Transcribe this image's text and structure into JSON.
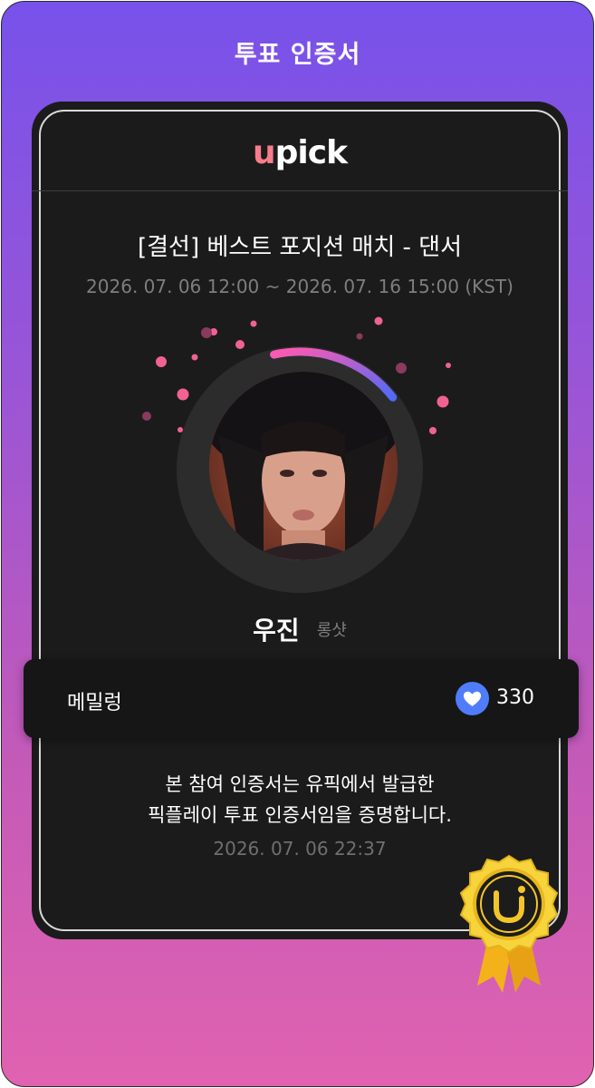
{
  "header": {
    "title": "투표 인증서"
  },
  "card": {
    "logo": {
      "u": "u",
      "rest": "pick"
    },
    "vote_title": "[결선] 베스트 포지션 매치 - 댄서",
    "vote_period": "2026. 07. 06 12:00 ~ 2026. 07. 16 15:00 (KST)",
    "progress_fraction": 0.18,
    "candidate": {
      "name": "우진",
      "group": "롱샷"
    },
    "voter": {
      "name": "메밀렁",
      "votes": "330"
    },
    "certificate_line1": "본 참여 인증서는 유픽에서 발급한",
    "certificate_line2": "픽플레이 투표 인증서임을 증명합니다.",
    "issued_at": "2026. 07. 06 22:37"
  },
  "colors": {
    "bg_top": "#7752ea",
    "bg_bottom": "#e062b0",
    "card": "#1b1b1b",
    "accent_pink": "#f06292",
    "accent_blue": "#5b6af5",
    "heart_badge": "#4f7dfa",
    "medal_gold": "#f2c21b"
  },
  "icons": {
    "heart": "heart-icon",
    "medal": "certificate-medal-icon",
    "avatar": "candidate-photo"
  }
}
